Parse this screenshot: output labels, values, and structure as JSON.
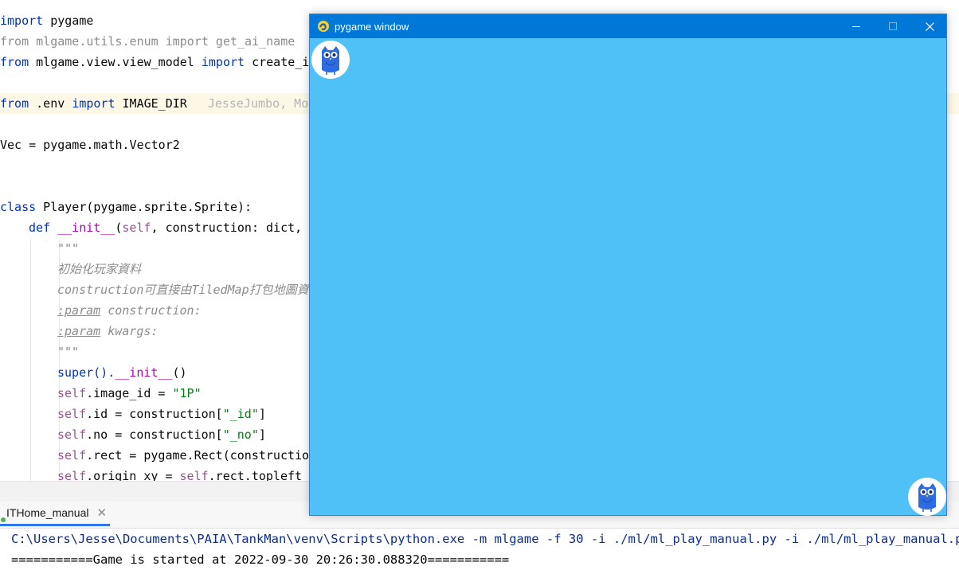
{
  "editor": {
    "line1": {
      "kw": "import",
      "rest": " pygame"
    },
    "line2": "from mlgame.utils.enum import get_ai_name",
    "line3": {
      "kw1": "from",
      "mod": " mlgame.view.view_model ",
      "kw2": "import",
      "rest": " create_i"
    },
    "line5": {
      "kw1": "from",
      "mod": " .env ",
      "kw2": "import",
      "rest": " IMAGE_DIR",
      "blame": "JesseJumbo, Mo"
    },
    "line7": "Vec = pygame.math.Vector2",
    "line10": {
      "kw": "class",
      "rest": " Player(pygame.sprite.Sprite):"
    },
    "line11": {
      "kw": "def",
      "name": " __init__",
      "p1": "(",
      "self": "self",
      "rest": ", construction: dict,"
    },
    "doc_open": "\"\"\"",
    "doc1": "初始化玩家資料",
    "doc2": "construction可直接由TiledMap打包地圖資",
    "doc3_tag": ":param",
    "doc3_rest": " construction:",
    "doc4_tag": ":param",
    "doc4_rest": " kwargs:",
    "doc_close": "\"\"\"",
    "super_a": "super().",
    "super_b": "__init__",
    "super_c": "()",
    "img_self": "self",
    "img_rest": ".image_id = ",
    "img_str": "\"1P\"",
    "id_self": "self",
    "id_rest": ".id = construction[",
    "id_str": "\"_id\"",
    "id_end": "]",
    "no_self": "self",
    "no_rest": ".no = construction[",
    "no_str": "\"_no\"",
    "no_end": "]",
    "rect_self": "self",
    "rect_rest": ".rect = pygame.Rect(constructio",
    "orig_self": "self",
    "orig_rest": ".origin_xy = ",
    "orig_self2": "self",
    "orig_rest2": ".rect.topleft"
  },
  "run_tab": {
    "label": "ITHome_manual",
    "close": "✕"
  },
  "console": {
    "command": "C:\\Users\\Jesse\\Documents\\PAIA\\TankMan\\venv\\Scripts\\python.exe -m mlgame -f 30 -i ./ml/ml_play_manual.py -i ./ml/ml_play_manual.py .",
    "output": "===========Game is started at 2022-09-30 20:26:30.088320==========="
  },
  "pygame_window": {
    "title": "pygame window",
    "minimize": "—",
    "maximize": "☐",
    "close": "✕",
    "background_color": "#4fc1f6",
    "titlebar_color": "#0078d7"
  },
  "icons": {
    "window_icon": "pygame-snake-icon",
    "player1": "owl-avatar-icon",
    "player2": "owl-avatar-icon"
  }
}
